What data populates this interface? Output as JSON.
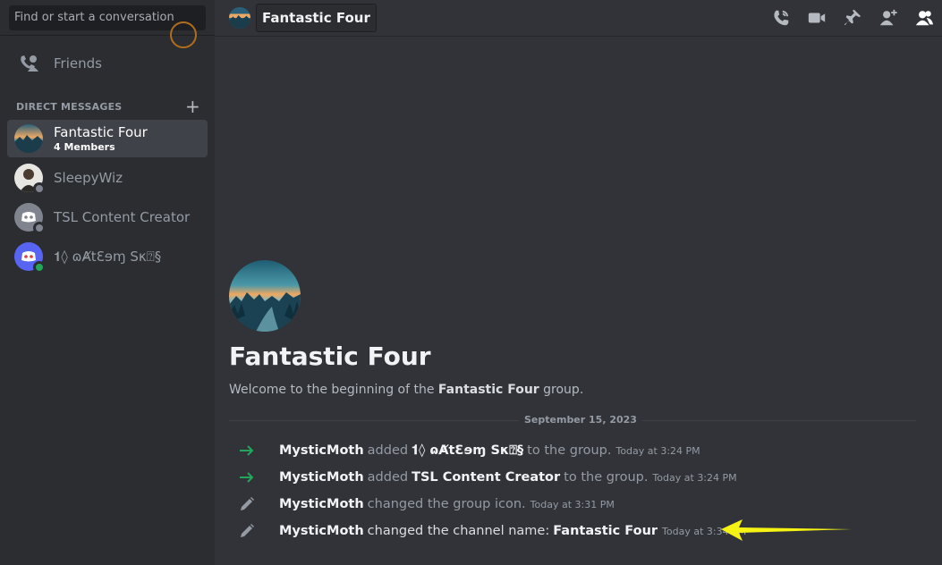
{
  "search": {
    "placeholder": "Find or start a conversation"
  },
  "sidebar": {
    "friends_label": "Friends",
    "dm_header": "DIRECT MESSAGES",
    "dm_add": "+",
    "items": [
      {
        "name": "Fantastic Four",
        "sub": "4 Members",
        "active": true
      },
      {
        "name": "SleepyWiz",
        "status": "offline"
      },
      {
        "name": "TSL Content Creator",
        "status": "offline"
      },
      {
        "name": "𝟏◊ ɷȺtƐɘɱ Sκ⍰§",
        "status": "online"
      }
    ]
  },
  "topbar": {
    "title": "Fantastic Four",
    "icons": [
      "call-icon",
      "video-icon",
      "pin-icon",
      "add-member-icon",
      "members-icon"
    ]
  },
  "main": {
    "group_title": "Fantastic Four",
    "welcome_pre": "Welcome to the beginning of the ",
    "welcome_bold": "Fantastic Four",
    "welcome_post": " group.",
    "date_divider": "September 15, 2023",
    "messages": [
      {
        "icon": "join-arrow-icon",
        "user": "MysticMoth",
        "action": "added",
        "target": "𝟏◊ ɷȺtƐɘɱ Sκ⍰§",
        "suffix": "to the group.",
        "time": "Today at 3:24 PM"
      },
      {
        "icon": "join-arrow-icon",
        "user": "MysticMoth",
        "action": "added",
        "target": "TSL Content Creator",
        "suffix": "to the group.",
        "time": "Today at 3:24 PM"
      },
      {
        "icon": "pencil-icon",
        "user": "MysticMoth",
        "action": "changed the group icon.",
        "time": "Today at 3:31 PM"
      },
      {
        "icon": "pencil-icon",
        "user": "MysticMoth",
        "action": "changed the channel name:",
        "target": "Fantastic Four",
        "time": "Today at 3:34 PM"
      }
    ]
  },
  "colors": {
    "accent_green": "#23a55a",
    "annotation_yellow": "#f5f214",
    "indicator_orange": "#b06d1d"
  }
}
